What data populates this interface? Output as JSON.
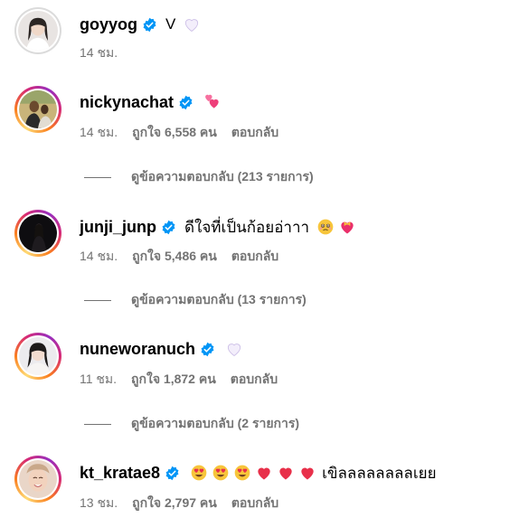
{
  "colors": {
    "verified_badge": "#0095f6",
    "secondary_text": "#737373",
    "primary_text": "#000000"
  },
  "comments": [
    {
      "username": "goyyog",
      "verified": true,
      "text": "V",
      "emojis_after_text": [
        "white-heart"
      ],
      "time": "14 ชม.",
      "likes": "",
      "reply": "",
      "view_replies": ""
    },
    {
      "username": "nickynachat",
      "verified": true,
      "text": "",
      "emojis": [
        "two-hearts"
      ],
      "time": "14 ชม.",
      "likes": "ถูกใจ 6,558 คน",
      "reply": "ตอบกลับ",
      "view_replies": "ดูข้อความตอบกลับ (213 รายการ)"
    },
    {
      "username": "junji_junp",
      "verified": true,
      "text": "ดีใจที่เป็นก้อยอ่าาา",
      "emojis_after_text": [
        "face-holding-back-tears",
        "heart-with-ribbon"
      ],
      "time": "14 ชม.",
      "likes": "ถูกใจ 5,486 คน",
      "reply": "ตอบกลับ",
      "view_replies": "ดูข้อความตอบกลับ (13 รายการ)"
    },
    {
      "username": "nuneworanuch",
      "verified": true,
      "text": "",
      "emojis": [
        "white-heart"
      ],
      "time": "11 ชม.",
      "likes": "ถูกใจ 1,872 คน",
      "reply": "ตอบกลับ",
      "view_replies": "ดูข้อความตอบกลับ (2 รายการ)"
    },
    {
      "username": "kt_kratae8",
      "verified": true,
      "text": "เขิลลลลลลลลเยย",
      "emojis": [
        "heart-eyes",
        "heart-eyes",
        "heart-eyes",
        "red-heart",
        "red-heart",
        "red-heart"
      ],
      "time": "13 ชม.",
      "likes": "ถูกใจ 2,797 คน",
      "reply": "ตอบกลับ",
      "view_replies": ""
    }
  ]
}
